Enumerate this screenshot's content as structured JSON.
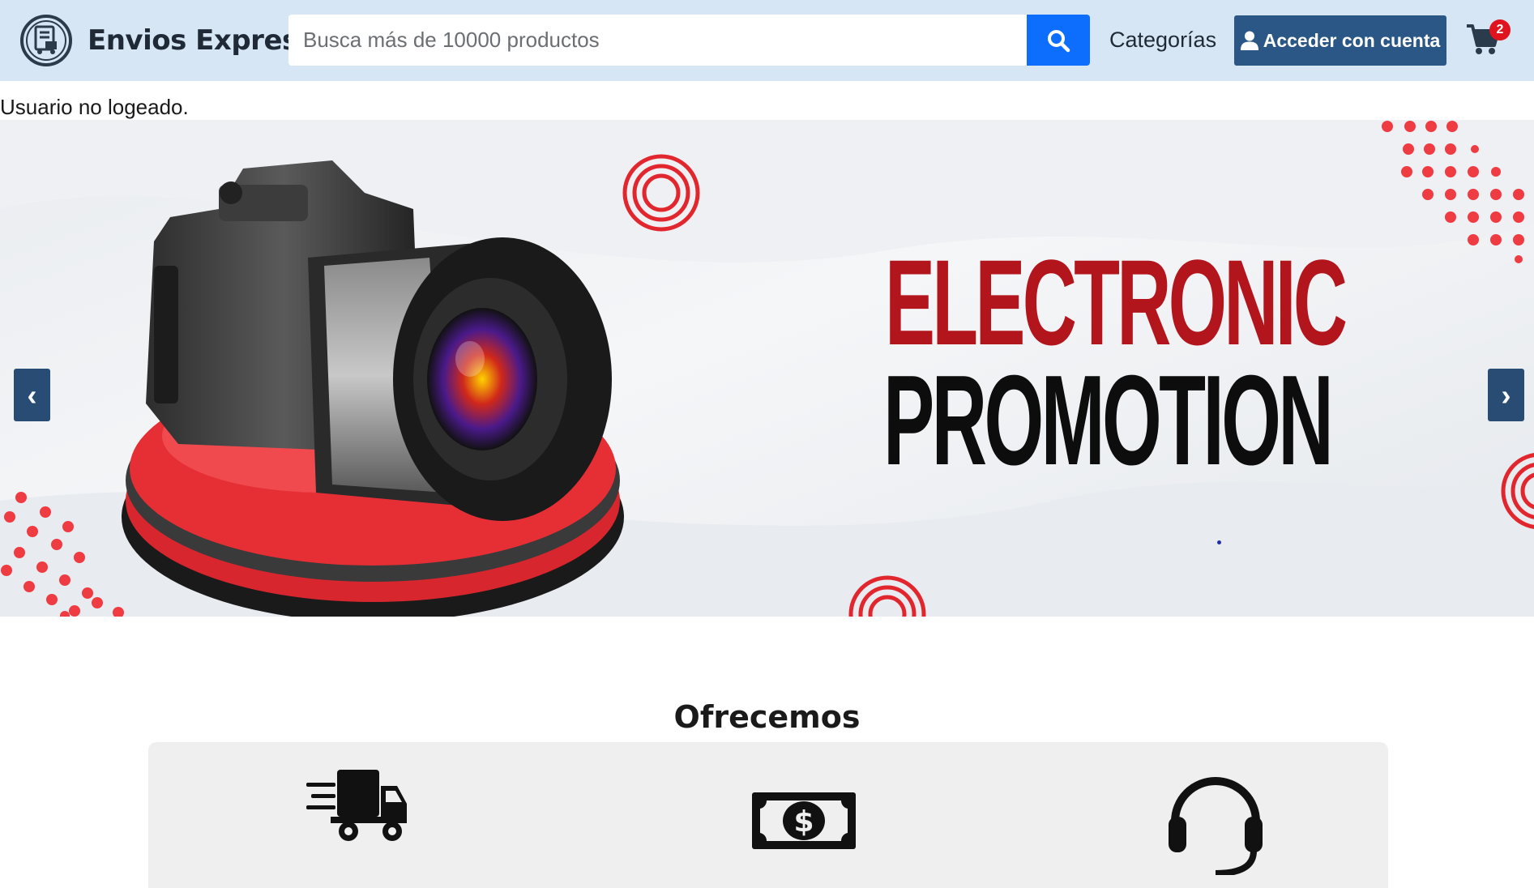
{
  "header": {
    "brand": "Envios Express",
    "search_placeholder": "Busca más de 10000 productos",
    "categories_label": "Categorías",
    "login_label": "Acceder con cuenta",
    "cart_count": "2"
  },
  "status_text": "Usuario no logeado.",
  "carousel": {
    "line1": "ELECTRONIC",
    "line2": "PROMOTION",
    "prev_label": "‹",
    "next_label": "›"
  },
  "offers": {
    "title": "Ofrecemos",
    "items": [
      {
        "icon": "delivery-truck-icon"
      },
      {
        "icon": "money-bill-icon"
      },
      {
        "icon": "headset-support-icon"
      }
    ]
  },
  "colors": {
    "header_bg": "#d6e6f4",
    "search_button": "#0d6efd",
    "login_button": "#2a5785",
    "promo_red": "#b3151d",
    "badge_red": "#e0141e",
    "carousel_arrow": "#284c74"
  }
}
